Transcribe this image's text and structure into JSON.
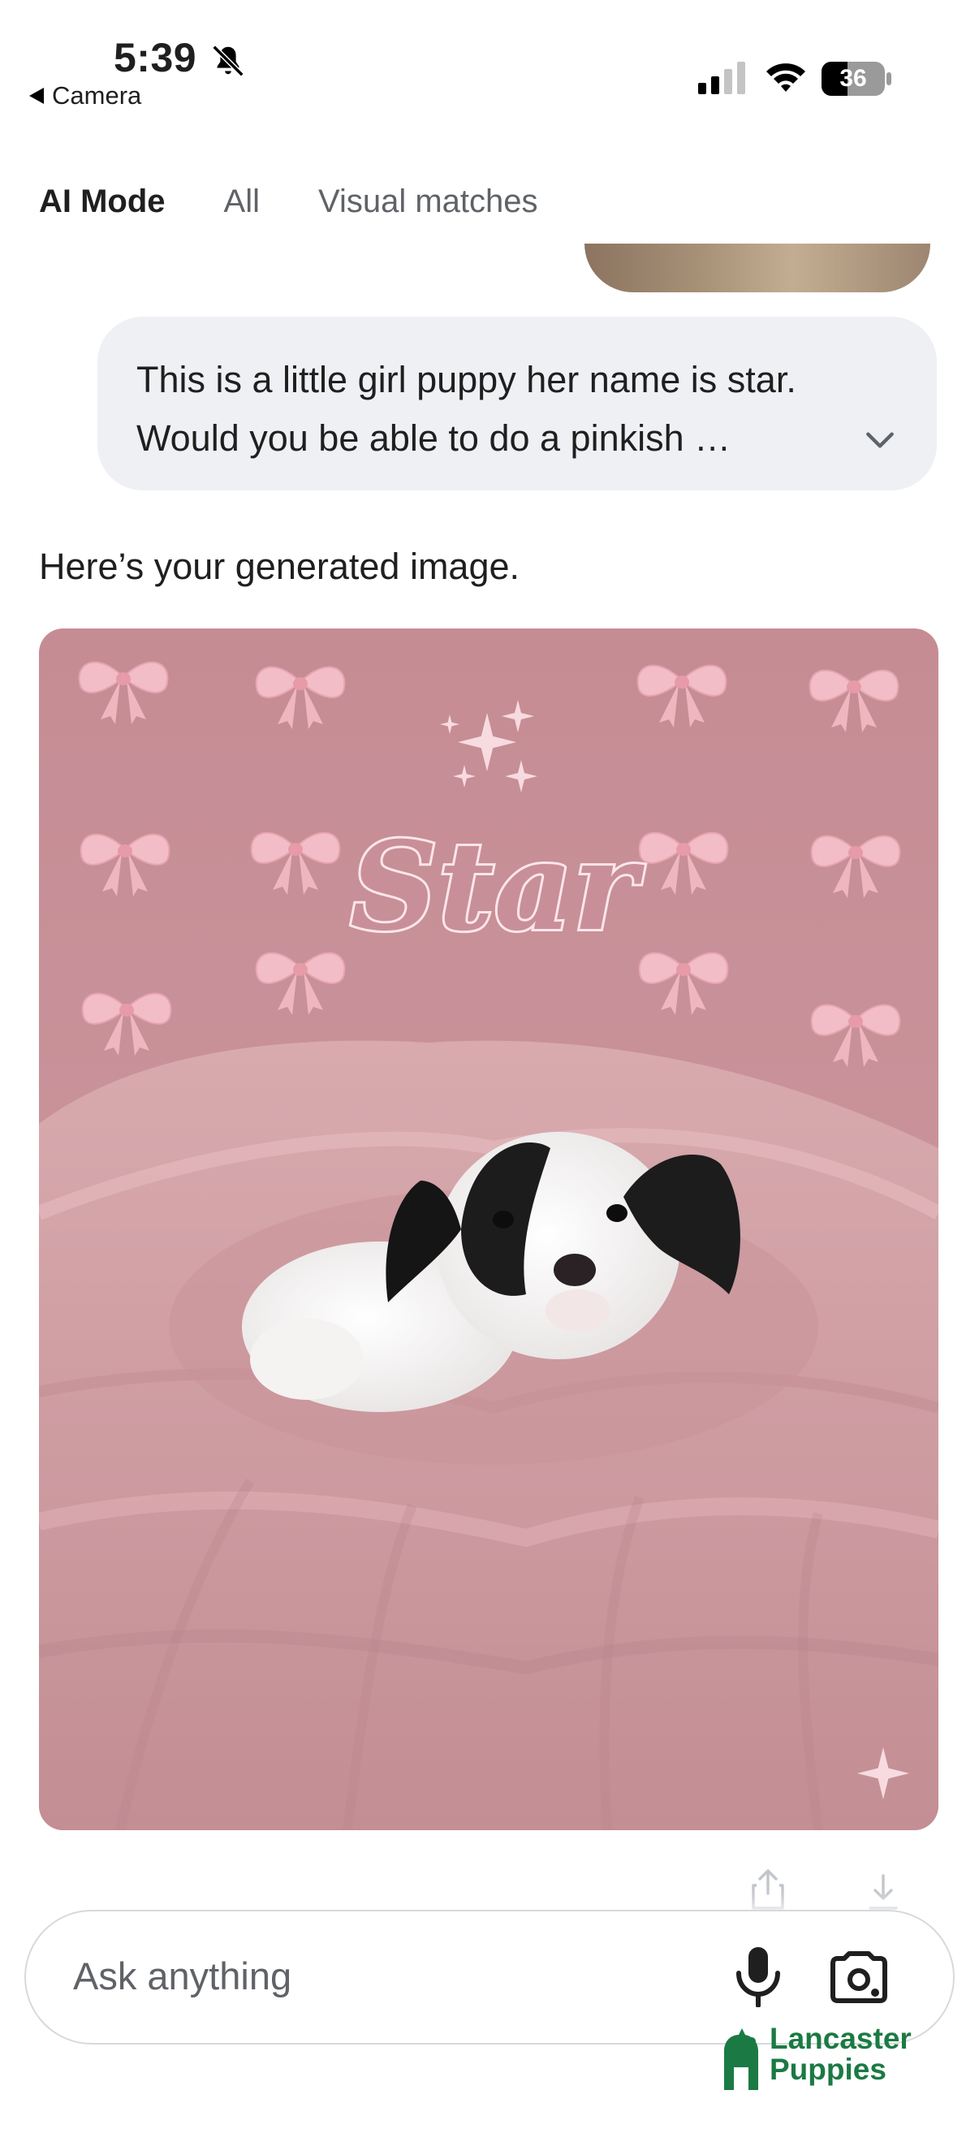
{
  "status_bar": {
    "time": "5:39",
    "back_app": "Camera",
    "battery_level": "36"
  },
  "tabs": [
    {
      "label": "AI Mode",
      "active": true
    },
    {
      "label": "All",
      "active": false
    },
    {
      "label": "Visual matches",
      "active": false
    }
  ],
  "user_message": {
    "text": "This is a little girl puppy her name is star. Would you be able to do a pinkish …"
  },
  "reply": {
    "text": "Here’s your generated image."
  },
  "generated_image": {
    "name_text": "Star"
  },
  "input": {
    "placeholder": "Ask anything"
  },
  "watermark": {
    "line1": "Lancaster",
    "line2": "Puppies"
  },
  "colors": {
    "accent_green": "#1b7a43",
    "bubble_bg": "#eef0f4",
    "wall_pink": "#c98f96"
  }
}
